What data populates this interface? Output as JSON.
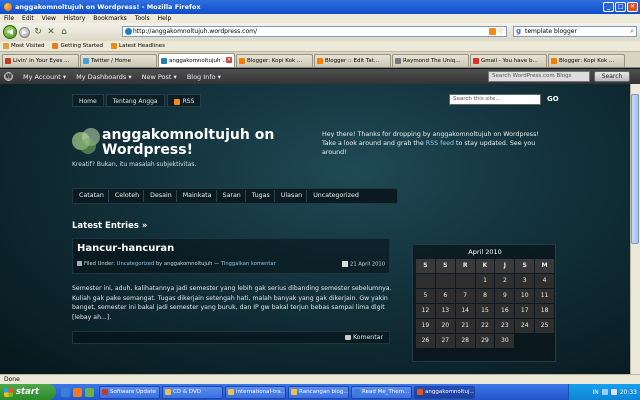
{
  "window": {
    "title": "anggakomnoltujuh on Wordpress! - Mozilla Firefox",
    "minimize": "_",
    "maximize": "□",
    "close": "✕"
  },
  "menu": [
    "File",
    "Edit",
    "View",
    "History",
    "Bookmarks",
    "Tools",
    "Help"
  ],
  "nav": {
    "url": "http://anggakomnoltujuh.wordpress.com/",
    "search_value": "template blogger",
    "back": "◀",
    "forward": "▶",
    "reload": "↻",
    "stop": "✕",
    "home": "⌂"
  },
  "bookmarks": [
    {
      "label": "Most Visited",
      "color": "#d8a43c"
    },
    {
      "label": "Getting Started",
      "color": "#e67c24"
    },
    {
      "label": "Latest Headlines",
      "color": "#f58a19"
    }
  ],
  "tabs": [
    {
      "label": "Livin' in Your Eyes ...",
      "color": "#c0392b",
      "active": false
    },
    {
      "label": "Twitter / Home",
      "color": "#45a0d8",
      "active": false
    },
    {
      "label": "anggakomnoltujuh ...",
      "color": "#1f7fb8",
      "active": true
    },
    {
      "label": "Blogger: Kopi Kok ...",
      "color": "#f57d00",
      "active": false
    },
    {
      "label": "Blogger :: Edit Tat...",
      "color": "#f57d00",
      "active": false
    },
    {
      "label": "Raymond The Uniq...",
      "color": "#777777",
      "active": false
    },
    {
      "label": "Gmail - You have b...",
      "color": "#d93025",
      "active": false
    },
    {
      "label": "Blogger: Kopi Kok ...",
      "color": "#f57d00",
      "active": false
    }
  ],
  "wpbar": {
    "items": [
      "My Account ▾",
      "My Dashboards ▾",
      "New Post ▾",
      "Blog Info ▾"
    ],
    "logo": "W",
    "search_placeholder": "Search WordPress.com Blogs",
    "search_button": "Search"
  },
  "site": {
    "topnav": [
      "Home",
      "Tentang Angga",
      "RSS"
    ],
    "search_placeholder": "Search this site...",
    "go": "GO",
    "title": "anggakomnoltujuh on Wordpress!",
    "tagline": "Kreatif? Bukan, itu masalah subjektivitas.",
    "welcome_pre": "Hey there! Thanks for dropping by anggakomnoltujuh on Wordpress! Take a look around and grab the ",
    "welcome_link": "RSS feed",
    "welcome_post": " to stay updated. See you around!",
    "categories": [
      "Catatan",
      "Celoteh",
      "Desain",
      "Mainkata",
      "Saran",
      "Tugas",
      "Ulasan",
      "Uncategorized"
    ],
    "latest_heading": "Latest Entries »",
    "post": {
      "title": "Hancur-hancuran",
      "filed_under": "Filed Under: ",
      "category": "Uncategorized",
      "by": " by anggakomnoltujuh — ",
      "comment_link": "Tinggalkan komentar",
      "date": "21 April 2010",
      "excerpt": "Semester ini, aduh, kalihatannya jadi semester yang lebih gak serius dibanding semester sebelumnya. Kuliah gak pake semangat. Tugas dikerjain setengah hati, malah banyak yang gak dikerjain. Gw yakin banget, semester ini bakal jadi semester yang buruk, dan IP gw bakal terjun bebas sampai lima digit [lebay ah...].",
      "komentar": "Komentar"
    },
    "calendar": {
      "caption": "April 2010",
      "headers": [
        "S",
        "S",
        "R",
        "K",
        "J",
        "S",
        "M"
      ],
      "leading_blanks": 3,
      "days": [
        "1",
        "2",
        "3",
        "4",
        "5",
        "6",
        "7",
        "8",
        "9",
        "10",
        "11",
        "12",
        "13",
        "14",
        "15",
        "16",
        "17",
        "18",
        "19",
        "20",
        "21",
        "22",
        "23",
        "24",
        "25",
        "26",
        "27",
        "28",
        "29",
        "30"
      ]
    }
  },
  "status": "Done",
  "taskbar": {
    "start": "start",
    "quicklaunch": [
      "#3b7fd8",
      "#f07a1c",
      "#6ab04c"
    ],
    "tasks": [
      {
        "label": "Software Update",
        "color": "#c0392b",
        "active": false
      },
      {
        "label": "CD & DVD",
        "color": "#f0c040",
        "active": false
      },
      {
        "label": "international-tra...",
        "color": "#f0c040",
        "active": false
      },
      {
        "label": "Rancangan blog...",
        "color": "#f0c040",
        "active": false
      },
      {
        "label": "Read Me_Them...",
        "color": "#3b7fd8",
        "active": false
      },
      {
        "label": "anggakomnoltuj...",
        "color": "#e25a10",
        "active": true
      }
    ],
    "tray_lang": "IN",
    "clock": "20:33"
  }
}
